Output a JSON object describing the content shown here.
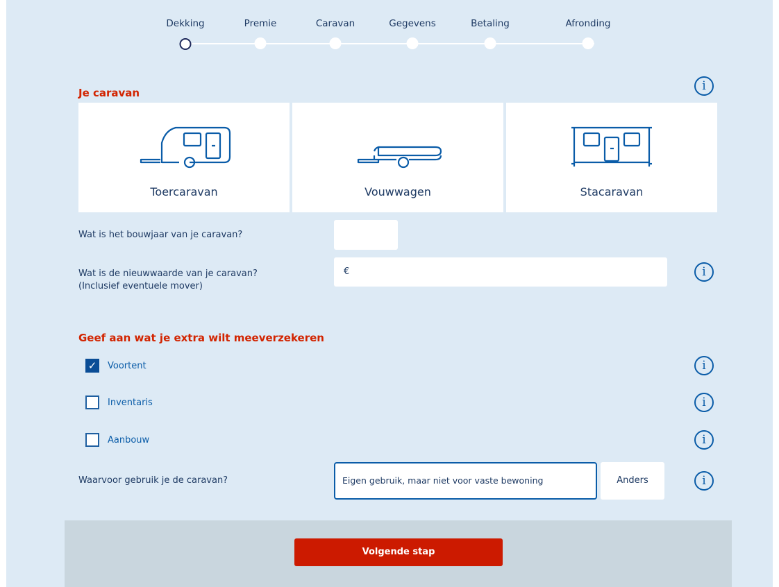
{
  "stepper": {
    "steps": [
      {
        "label": "Dekking",
        "active": true
      },
      {
        "label": "Premie",
        "active": false
      },
      {
        "label": "Caravan",
        "active": false
      },
      {
        "label": "Gegevens",
        "active": false
      },
      {
        "label": "Betaling",
        "active": false
      },
      {
        "label": "Afronding",
        "active": false
      }
    ]
  },
  "caravan_section": {
    "title": "Je caravan",
    "types": [
      {
        "label": "Toercaravan",
        "icon": "touring-caravan-icon"
      },
      {
        "label": "Vouwwagen",
        "icon": "folding-trailer-icon"
      },
      {
        "label": "Stacaravan",
        "icon": "mobile-home-icon"
      }
    ]
  },
  "form": {
    "build_year_label": "Wat is het bouwjaar van je caravan?",
    "build_year_value": "",
    "new_value_label_line1": "Wat is de nieuwwaarde van je caravan?",
    "new_value_label_line2": "(Inclusief eventuele mover)",
    "new_value_currency": "€",
    "new_value_value": ""
  },
  "extras_section": {
    "title": "Geef aan wat je extra wilt meeverzekeren",
    "options": [
      {
        "label": "Voortent",
        "checked": true
      },
      {
        "label": "Inventaris",
        "checked": false
      },
      {
        "label": "Aanbouw",
        "checked": false
      }
    ]
  },
  "usage": {
    "label": "Waarvoor gebruik je de caravan?",
    "selected_option": "Eigen gebruik, maar niet voor vaste bewoning",
    "other_option": "Anders"
  },
  "info_icon_glyph": "i",
  "checkmark_glyph": "✓",
  "footer": {
    "next_button_label": "Volgende stap"
  },
  "colors": {
    "accent_red": "#d22400",
    "button_red": "#cc1a00",
    "primary_blue": "#0a5ca8",
    "background": "#ddeaf5"
  }
}
